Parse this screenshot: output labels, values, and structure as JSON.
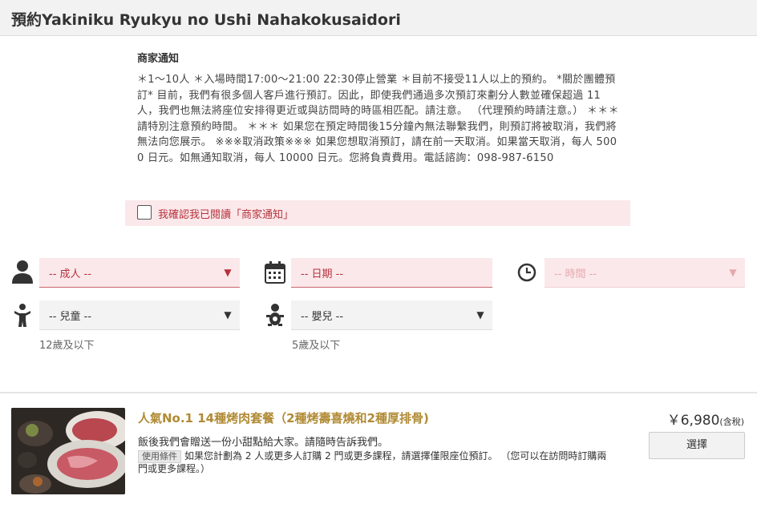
{
  "header": {
    "title": "預約Yakiniku Ryukyu no Ushi Nahakokusaidori"
  },
  "notice": {
    "title": "商家通知",
    "body": "＊1〜10人 ＊入場時間17:00〜21:00 22:30停止營業 ＊目前不接受11人以上的預約。 *關於團體預訂* 目前，我們有很多個人客戶進行預訂。因此，即使我們通過多次預訂來劃分人數並確保超過 11 人，我們也無法將座位安排得更近或與訪問時的時區相匹配。請注意。 （代理預約時請注意。） ＊＊＊請特別注意預約時間。 ＊＊＊ 如果您在預定時間後15分鐘內無法聯繫我們，則預訂將被取消，我們將無法向您展示。 ※※※取消政策※※※ 如果您想取消預訂，請在前一天取消。如果當天取消，每人 5000 日元。如無通知取消，每人 10000 日元。您將負責費用。電話諮詢：098-987-6150"
  },
  "confirm": {
    "label": "我確認我已閱讀「商家通知」",
    "checked": false
  },
  "form": {
    "adults": {
      "selected": "-- 成人 --",
      "icon": "person-icon"
    },
    "date": {
      "selected": "-- 日期 --",
      "icon": "calendar-icon"
    },
    "time": {
      "selected": "-- 時間 --",
      "icon": "clock-icon"
    },
    "children": {
      "selected": "-- 兒童 --",
      "icon": "child-icon",
      "hint": "12歲及以下"
    },
    "babies": {
      "selected": "-- 嬰兒 --",
      "icon": "baby-icon",
      "hint": "5歲及以下"
    }
  },
  "course": {
    "title": "人氣No.1 14種烤肉套餐（2種烤壽喜燒和2種厚排骨)",
    "description": "飯後我們會贈送一份小甜點給大家。請隨時告訴我們。",
    "terms_badge": "使用條件",
    "terms": "如果您計劃為 2 人或更多人訂購 2 門或更多課程，請選擇僅限座位預訂。 （您可以在訪問時訂購兩門或更多課程。）",
    "price": "￥6,980",
    "tax_note": "(含稅)",
    "select_label": "選擇"
  },
  "colors": {
    "accent_red": "#b5323c",
    "required_bg": "#fbe8ea",
    "gold": "#b08a34"
  }
}
